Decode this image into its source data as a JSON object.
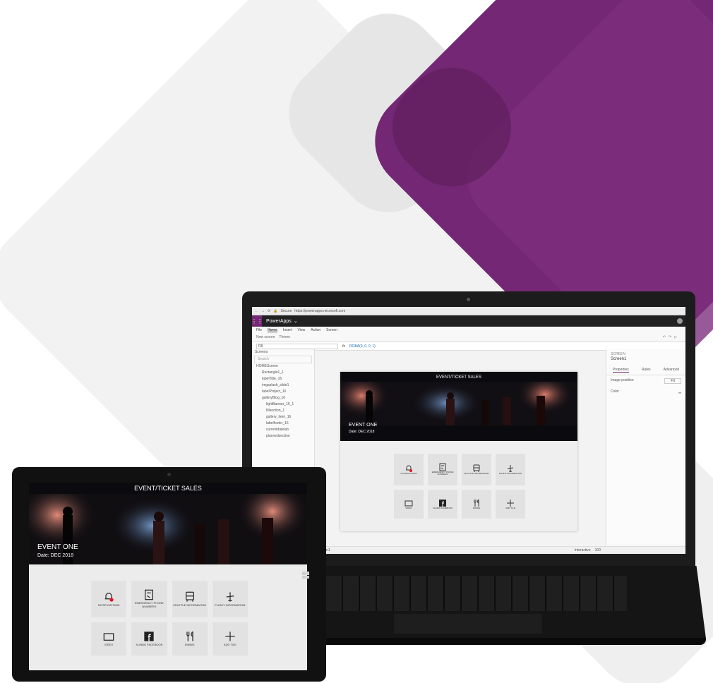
{
  "colors": {
    "brand_purple": "#742774",
    "banner_dark": "#0b0b0f",
    "tile_bg": "#e2e2e2",
    "notification_dot": "#e81123"
  },
  "browser": {
    "secure_label": "Secure",
    "url": "https://powerapps.microsoft.com"
  },
  "app": {
    "name": "PowerApps",
    "menu": [
      "File",
      "Home",
      "Insert",
      "View",
      "Action",
      "Screen"
    ],
    "ribbon": [
      "New screen",
      "Theme"
    ],
    "property": "Fill",
    "formula": "RGBA(0, 0, 0, 1)",
    "tree_header": "Screens",
    "tree_search_placeholder": "Search",
    "tree_items": [
      "HOMEScreen",
      "Rectangle1_1",
      "labelTitle_16",
      "imgsplash_slide1",
      "labelProject_16",
      "galleryBlog_16",
      "lightBanner_16_1",
      "fillsection_1",
      "gallery_item_16",
      "labelfooter_16",
      "currentdatelab",
      "plannedsection"
    ],
    "props_header": "SCREEN",
    "props_screen_name": "Screen1",
    "props_tabs": [
      "Properties",
      "Rules",
      "Advanced"
    ],
    "props_rows": [
      "Image position",
      "Color"
    ],
    "props_image_position_value": "Fit",
    "status_left": "Screen1",
    "status_interactive": "Interactive",
    "status_zoom": "100"
  },
  "event_app": {
    "title": "EVENT/TICKET SALES",
    "event_name": "EVENT ONE",
    "event_date": "Date: DEC 2018",
    "tiles": [
      {
        "icon": "bell-icon",
        "label": "NOTIFICATIONS"
      },
      {
        "icon": "phone-book-icon",
        "label": "EMERGENCY PHONE NUMBERS"
      },
      {
        "icon": "bus-icon",
        "label": "SHUTTLE INFORMATION"
      },
      {
        "icon": "airplane-icon",
        "label": "FLIGHT INFORMATION"
      },
      {
        "icon": "video-icon",
        "label": "VIDEO"
      },
      {
        "icon": "facebook-icon",
        "label": "XLINDD FACEBOOK"
      },
      {
        "icon": "dining-icon",
        "label": "DINING"
      },
      {
        "icon": "plus-icon",
        "label": "ADD TILE"
      }
    ]
  }
}
